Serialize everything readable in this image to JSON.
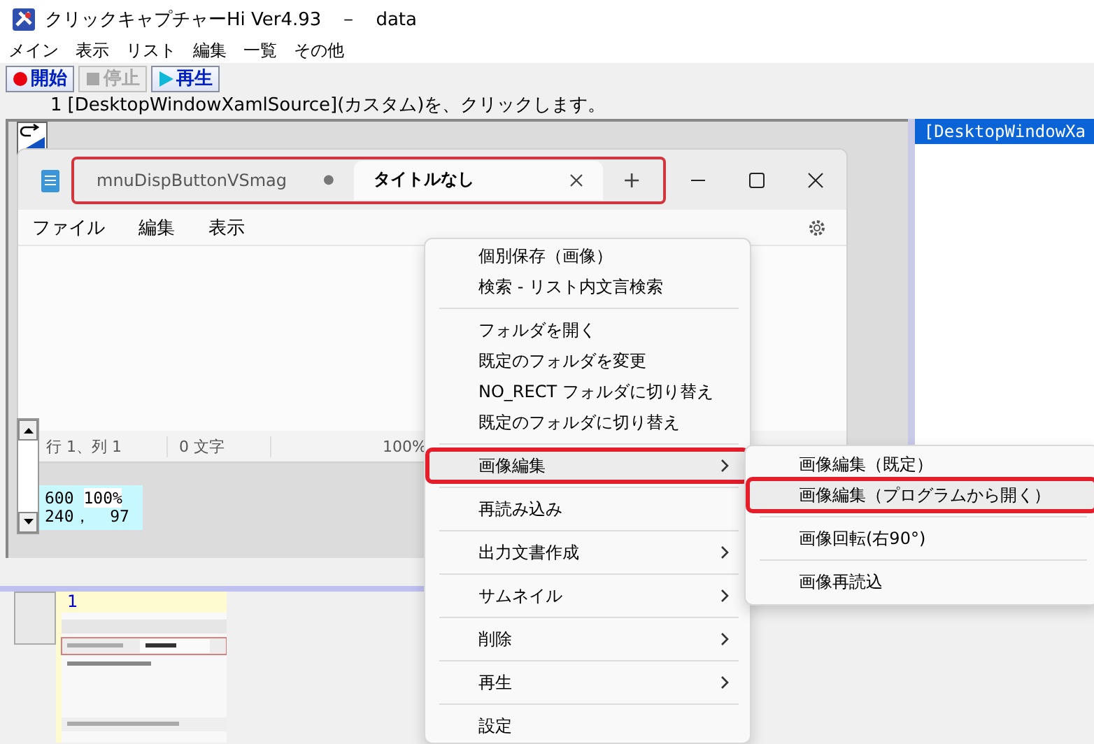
{
  "window": {
    "title": "クリックキャプチャーHi Ver4.93　－　data"
  },
  "menu_bar": [
    "メイン",
    "表示",
    "リスト",
    "編集",
    "一覧",
    "その他"
  ],
  "toolbar": [
    {
      "kind": "record",
      "label": "開始",
      "disabled": false
    },
    {
      "kind": "stop",
      "label": "停止",
      "disabled": true
    },
    {
      "kind": "play",
      "label": "再生",
      "disabled": false
    }
  ],
  "step": {
    "number": "1",
    "text": "[DesktopWindowXamlSource](カスタム)を、クリックします。"
  },
  "preview": {
    "notepad": {
      "tabs_highlighted": true,
      "tabs": [
        {
          "label": "mnuDispButtonVSmag",
          "selected": false,
          "modified": true,
          "modified_mark": "●"
        },
        {
          "label": "タイトルなし",
          "selected": true,
          "modified": false
        }
      ],
      "new_tab": "+",
      "menu": [
        "ファイル",
        "編集",
        "表示"
      ],
      "status": [
        "行 1、列 1",
        "0 文字",
        "100%"
      ]
    },
    "readout": {
      "line_1": "600",
      "zoom": "100%",
      "line_2": "240，  97"
    }
  },
  "list": {
    "items": [
      {
        "label": "[DesktopWindowXa",
        "selected": true
      }
    ]
  },
  "thumbnails": [
    {
      "number": "1"
    }
  ],
  "context_menu": {
    "items": [
      {
        "kind": "item",
        "label": "個別保存（画像）",
        "submenu": false,
        "selected": false
      },
      {
        "kind": "item",
        "label": "検索 - リスト内文言検索",
        "submenu": false,
        "selected": false
      },
      {
        "kind": "separator"
      },
      {
        "kind": "item",
        "label": "フォルダを開く",
        "submenu": false,
        "selected": false
      },
      {
        "kind": "item",
        "label": "既定のフォルダを変更",
        "submenu": false,
        "selected": false
      },
      {
        "kind": "item",
        "label": "NO_RECT フォルダに切り替え",
        "submenu": false,
        "selected": false
      },
      {
        "kind": "item",
        "label": "既定のフォルダに切り替え",
        "submenu": false,
        "selected": false
      },
      {
        "kind": "separator"
      },
      {
        "kind": "item",
        "label": "画像編集",
        "submenu": true,
        "selected": true
      },
      {
        "kind": "separator"
      },
      {
        "kind": "item",
        "label": "再読み込み",
        "submenu": false,
        "selected": false
      },
      {
        "kind": "separator"
      },
      {
        "kind": "item",
        "label": "出力文書作成",
        "submenu": true,
        "selected": false
      },
      {
        "kind": "separator"
      },
      {
        "kind": "item",
        "label": "サムネイル",
        "submenu": true,
        "selected": false
      },
      {
        "kind": "separator"
      },
      {
        "kind": "item",
        "label": "削除",
        "submenu": true,
        "selected": false
      },
      {
        "kind": "separator"
      },
      {
        "kind": "item",
        "label": "再生",
        "submenu": true,
        "selected": false
      },
      {
        "kind": "separator"
      },
      {
        "kind": "item",
        "label": "設定",
        "submenu": false,
        "selected": false
      }
    ]
  },
  "submenu": {
    "items": [
      {
        "kind": "item",
        "label": "画像編集（既定）",
        "submenu": false,
        "selected": false
      },
      {
        "kind": "item",
        "label": "画像編集（プログラムから開く）",
        "submenu": false,
        "selected": true
      },
      {
        "kind": "separator"
      },
      {
        "kind": "item",
        "label": "画像回転(右90°)",
        "submenu": false,
        "selected": false
      },
      {
        "kind": "separator"
      },
      {
        "kind": "item",
        "label": "画像再読込",
        "submenu": false,
        "selected": false
      }
    ]
  }
}
